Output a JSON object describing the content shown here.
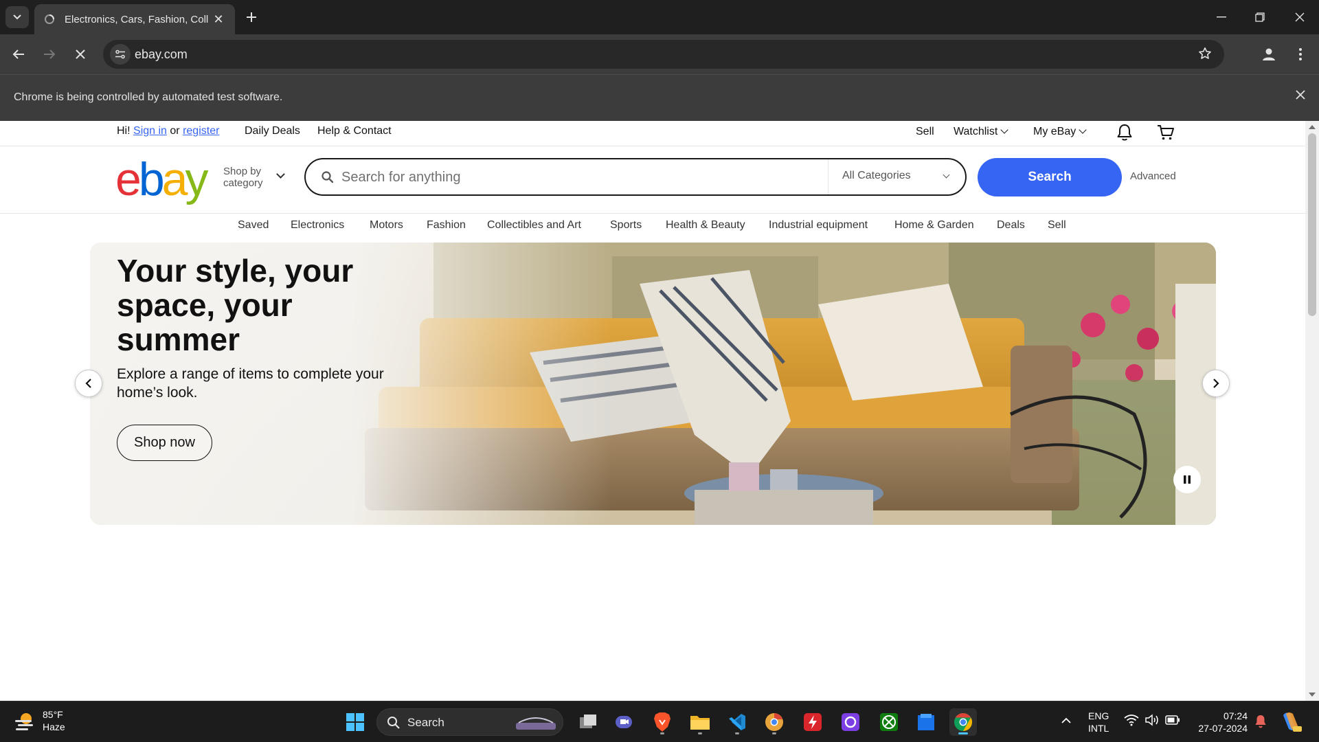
{
  "browser": {
    "tab_title": "Electronics, Cars, Fashion, Colle",
    "url": "ebay.com",
    "infobar_text": "Chrome is being controlled by automated test software."
  },
  "ebay": {
    "topbar": {
      "greeting": "Hi!",
      "sign_in": "Sign in",
      "or": "or",
      "register": "register",
      "daily_deals": "Daily Deals",
      "help_contact": "Help & Contact",
      "sell": "Sell",
      "watchlist": "Watchlist",
      "my_ebay": "My eBay"
    },
    "header": {
      "logo_letters": [
        "e",
        "b",
        "a",
        "y"
      ],
      "shop_by_line1": "Shop by",
      "shop_by_line2": "category",
      "search_placeholder": "Search for anything",
      "category_select": "All Categories",
      "search_button": "Search",
      "advanced": "Advanced"
    },
    "nav_categories": [
      "Saved",
      "Electronics",
      "Motors",
      "Fashion",
      "Collectibles and Art",
      "Sports",
      "Health & Beauty",
      "Industrial equipment",
      "Home & Garden",
      "Deals",
      "Sell"
    ],
    "hero": {
      "title": "Your style, your space, your summer",
      "subtitle": "Explore a range of items to complete your home’s look.",
      "cta": "Shop now"
    }
  },
  "taskbar": {
    "weather_temp": "85°F",
    "weather_desc": "Haze",
    "search_label": "Search",
    "lang_line1": "ENG",
    "lang_line2": "INTL",
    "time": "07:24",
    "date": "27-07-2024"
  },
  "colors": {
    "ebay_blue": "#3665f3",
    "logo_e": "#e53238",
    "logo_b": "#0064d2",
    "logo_a": "#f5af02",
    "logo_y": "#86b817"
  }
}
